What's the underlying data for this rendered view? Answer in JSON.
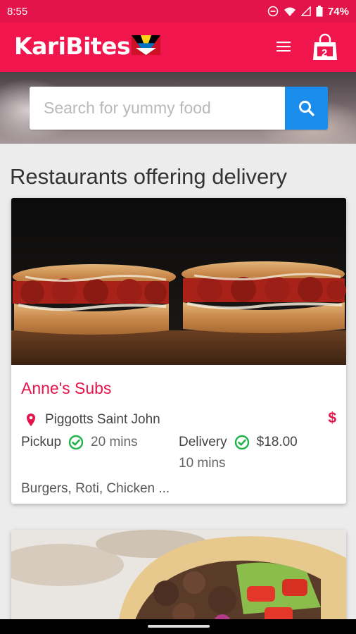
{
  "status_bar": {
    "time": "8:55",
    "battery": "74%"
  },
  "app_bar": {
    "brand": "KariBites",
    "cart_count": "2"
  },
  "search": {
    "placeholder": "Search for yummy food",
    "value": ""
  },
  "section": {
    "title": "Restaurants offering delivery"
  },
  "restaurants": [
    {
      "name": "Anne's Subs",
      "location": "Piggotts Saint John",
      "price_level": "$",
      "pickup_label": "Pickup",
      "pickup_time": "20 mins",
      "delivery_label": "Delivery",
      "delivery_fee": "$18.00",
      "delivery_time": "10 mins",
      "cuisines": "Burgers, Roti, Chicken ..."
    }
  ],
  "colors": {
    "brand": "#f0164d",
    "accent_blue": "#1a8ceb",
    "check_green": "#22b24c"
  },
  "icons": [
    "dnd-icon",
    "wifi-icon",
    "signal-icon",
    "battery-icon",
    "flag-icon",
    "menu-icon",
    "cart-icon",
    "search-icon",
    "location-pin-icon",
    "check-circle-icon"
  ]
}
